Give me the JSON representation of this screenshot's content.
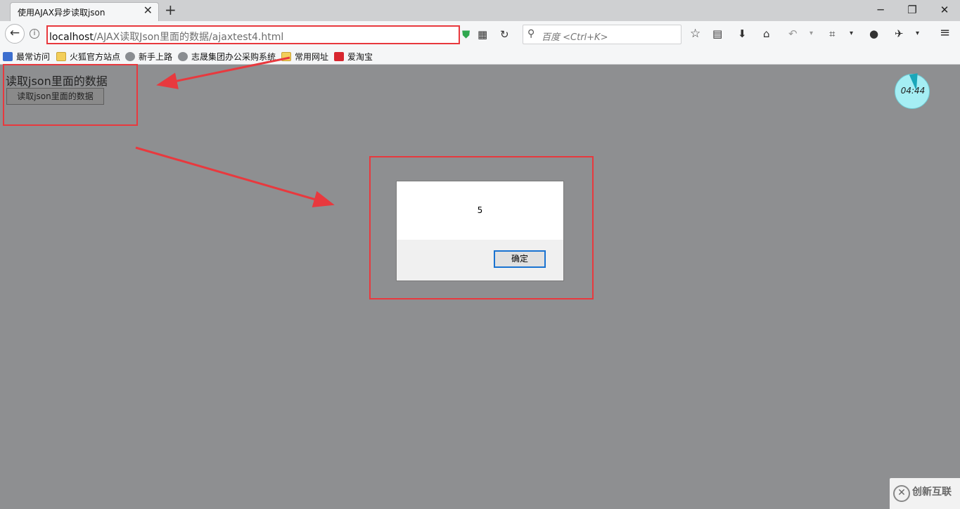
{
  "browser": {
    "tab_title": "使用AJAX异步读取json",
    "tab_close": "✕",
    "new_tab": "+",
    "window": {
      "minimize": "─",
      "restore": "❐",
      "close": "✕"
    },
    "url_host": "localhost",
    "url_path": "/AJAX读取Json里面的数据/ajaxtest4.html",
    "search_placeholder": "百度 <Ctrl+K>",
    "bookmarks": [
      {
        "label": "最常访问",
        "icon": "bookmark-blue-icon"
      },
      {
        "label": "火狐官方站点",
        "icon": "folder-icon"
      },
      {
        "label": "新手上路",
        "icon": "globe-icon"
      },
      {
        "label": "志晟集团办公采购系统",
        "icon": "globe-icon"
      },
      {
        "label": "常用网址",
        "icon": "folder-icon"
      },
      {
        "label": "爱淘宝",
        "icon": "taobao-icon"
      }
    ]
  },
  "page": {
    "heading": "读取json里面的数据",
    "button_label": "读取json里面的数据"
  },
  "dialog": {
    "message": "5",
    "ok_label": "确定"
  },
  "timer": {
    "text": "04:44"
  },
  "watermark": {
    "text": "创新互联"
  },
  "colors": {
    "highlight": "#e8393e",
    "page_bg": "#8e8f91",
    "dialog_focus": "#1a73d1"
  }
}
